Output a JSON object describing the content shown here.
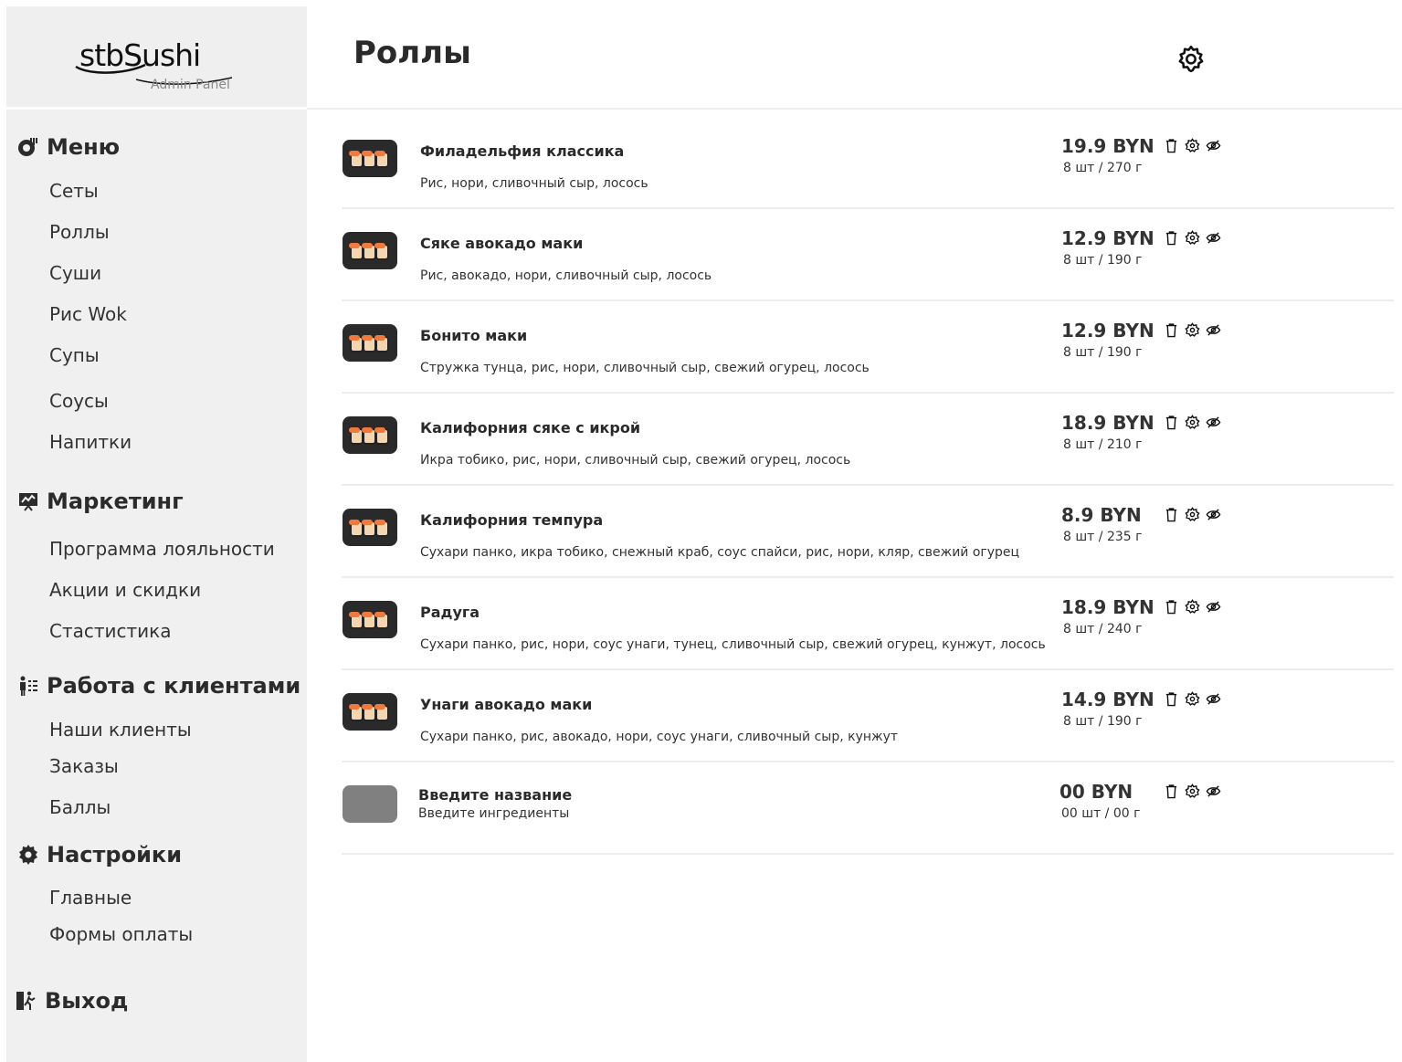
{
  "brand": {
    "logo_text": "stbSushi",
    "subtitle": "Admin Panel"
  },
  "header": {
    "title": "Роллы"
  },
  "sidebar": {
    "sections": [
      {
        "label": "Меню",
        "icon": "menu-icon",
        "items": [
          "Сеты",
          "Роллы",
          "Суши",
          "Рис Wok",
          "Супы",
          "Соусы",
          "Напитки"
        ]
      },
      {
        "label": "Маркетинг",
        "icon": "marketing-icon",
        "items": [
          "Программа лояльности",
          "Акции и скидки",
          "Стастистика"
        ]
      },
      {
        "label": "Работа с клиентами",
        "icon": "clients-icon",
        "items": [
          "Наши клиенты",
          "Заказы",
          "Баллы"
        ]
      },
      {
        "label": "Настройки",
        "icon": "settings-icon",
        "items": [
          "Главные",
          "Формы оплаты"
        ]
      },
      {
        "label": "Выход",
        "icon": "exit-icon",
        "items": []
      }
    ]
  },
  "products": [
    {
      "name": "Филадельфия классика",
      "ingredients": "Рис, нори, сливочный сыр, лосось",
      "price": "19.9 BYN",
      "weight": "8 шт / 270 г"
    },
    {
      "name": "Сяке авокадо маки",
      "ingredients": "Рис, авокадо, нори, сливочный сыр, лосось",
      "price": "12.9 BYN",
      "weight": "8 шт / 190 г"
    },
    {
      "name": "Бонито маки",
      "ingredients": "Стружка тунца, рис, нори, сливочный сыр, свежий огурец, лосось",
      "price": "12.9 BYN",
      "weight": "8 шт / 190 г"
    },
    {
      "name": "Калифорния сяке с икрой",
      "ingredients": "Икра тобико, рис, нори, сливочный сыр, свежий огурец, лосось",
      "price": "18.9 BYN",
      "weight": "8 шт / 210 г"
    },
    {
      "name": "Калифорния темпура",
      "ingredients": "Сухари панко, икра тобико, снежный краб, соус спайси, рис, нори, кляр, свежий огурец",
      "price": "8.9 BYN",
      "weight": "8 шт / 235 г"
    },
    {
      "name": "Радуга",
      "ingredients": "Сухари панко, рис, нори, соус унаги, тунец, сливочный сыр, свежий огурец, кунжут, лосось",
      "price": "18.9 BYN",
      "weight": "8 шт / 240 г"
    },
    {
      "name": "Унаги авокадо маки",
      "ingredients": "Сухари панко, рис, авокадо, нори, соус унаги, сливочный сыр, кунжут",
      "price": "14.9 BYN",
      "weight": "8 шт / 190 г"
    }
  ],
  "new_product": {
    "name": "Введите название",
    "ingredients": "Введите ингредиенты",
    "price": "00 BYN",
    "weight": "00 шт / 00 г"
  },
  "colors": {
    "sidebar_bg": "#f0f0f0",
    "text_dark": "#2a2a2a",
    "divider": "#ededed",
    "placeholder": "#808080"
  }
}
